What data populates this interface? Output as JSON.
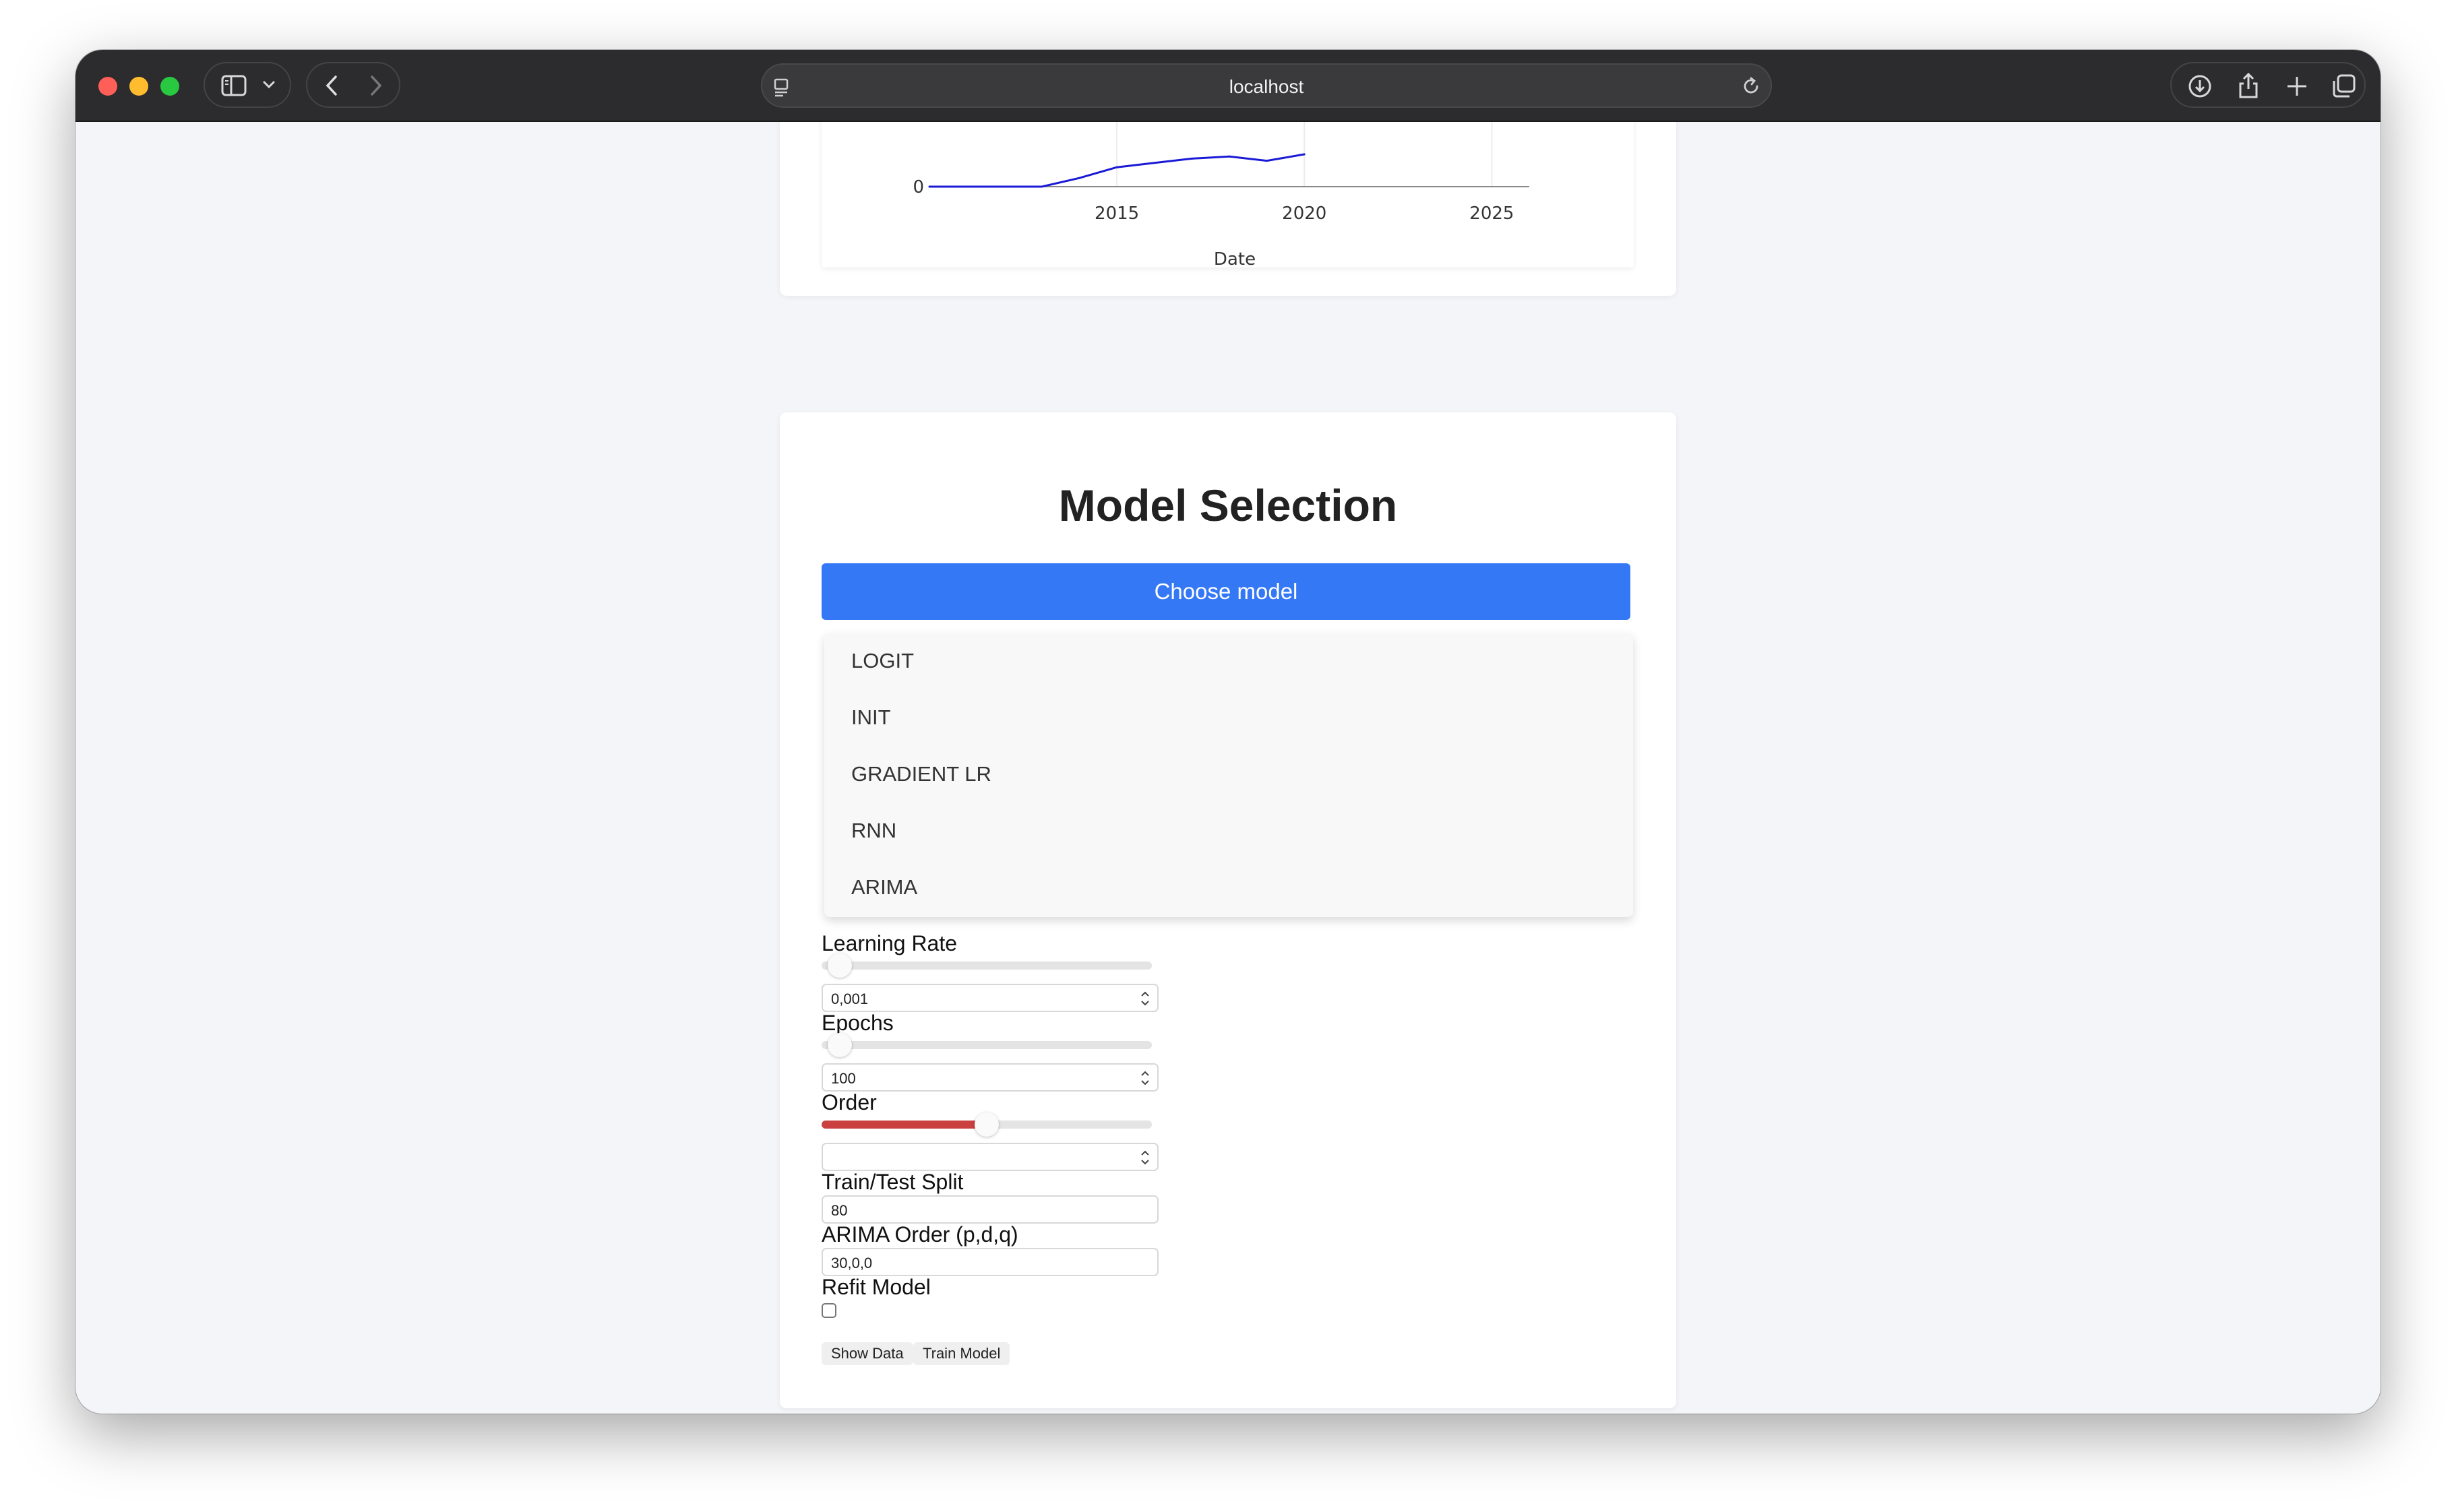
{
  "browser": {
    "url": "localhost"
  },
  "chart_data": {
    "type": "line",
    "x": [
      2010,
      2012,
      2013,
      2014,
      2015,
      2016,
      2017,
      2018,
      2019,
      2020
    ],
    "series": [
      {
        "values": [
          0,
          0,
          0,
          4,
          9,
          11,
          13,
          14,
          12,
          15
        ]
      }
    ],
    "xlabel": "Date",
    "x_ticks": [
      "2015",
      "2020",
      "2025"
    ],
    "y_ticks": [
      "0"
    ],
    "xlim": [
      2010,
      2026
    ],
    "line_color": "#1a1ad6"
  },
  "model_selection": {
    "title": "Model Selection",
    "choose_button": "Choose model",
    "options": [
      "LOGIT",
      "INIT",
      "GRADIENT LR",
      "RNN",
      "ARIMA"
    ]
  },
  "params": {
    "learning_rate_label": "Learning Rate",
    "learning_rate_value": "0,001",
    "learning_rate_level": 0.02,
    "epochs_label": "Epochs",
    "epochs_value": "100",
    "epochs_level": 0.02,
    "order_label": "Order",
    "order_value": "",
    "order_level": 0.5,
    "order_color": "#c9403f",
    "split_label": "Train/Test Split",
    "split_value": "80",
    "arima_label": "ARIMA Order (p,d,q)",
    "arima_value": "30,0,0",
    "refit_label": "Refit Model",
    "refit_checked": false
  },
  "actions": {
    "show_data": "Show Data",
    "train_model": "Train Model"
  },
  "colors": {
    "accent": "#3478f6"
  }
}
